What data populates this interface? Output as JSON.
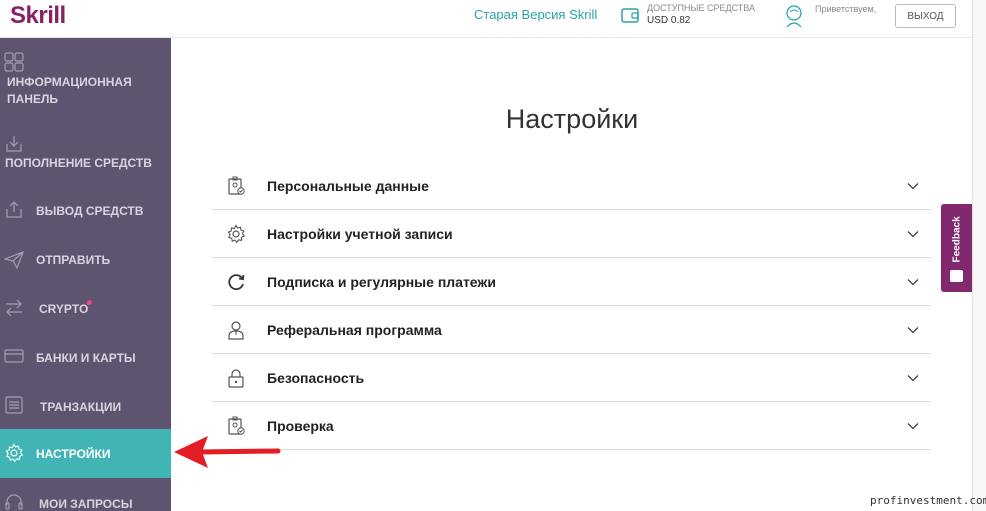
{
  "header": {
    "logo": "Skrill",
    "old_version_link": "Старая Версия Skrill",
    "balance_label": "ДОСТУПНЫЕ СРЕДСТВА",
    "balance_value": "USD 0.82",
    "greeting": "Приветствуем,",
    "logout_label": "ВЫХОД"
  },
  "sidebar": {
    "items": [
      {
        "label": "ИНФОРМАЦИОННАЯ ПАНЕЛЬ",
        "icon": "dashboard-icon"
      },
      {
        "label": "ПОПОЛНЕНИЕ СРЕДСТВ",
        "icon": "deposit-icon"
      },
      {
        "label": "ВЫВОД СРЕДСТВ",
        "icon": "withdraw-icon"
      },
      {
        "label": "ОТПРАВИТЬ",
        "icon": "send-icon"
      },
      {
        "label": "CRYPTO",
        "icon": "crypto-exchange-icon"
      },
      {
        "label": "БАНКИ И КАРТЫ",
        "icon": "bank-card-icon"
      },
      {
        "label": "ТРАНЗАКЦИИ",
        "icon": "transactions-icon"
      },
      {
        "label": "НАСТРОЙКИ",
        "icon": "gear-icon",
        "active": true
      },
      {
        "label": "МОИ ЗАПРОСЫ",
        "icon": "headset-icon"
      }
    ]
  },
  "main": {
    "title": "Настройки",
    "settings": [
      {
        "label": "Персональные данные",
        "icon": "id-badge-icon"
      },
      {
        "label": "Настройки учетной записи",
        "icon": "gear-icon"
      },
      {
        "label": "Подписка и регулярные платежи",
        "icon": "refresh-icon"
      },
      {
        "label": "Реферальная программа",
        "icon": "person-icon"
      },
      {
        "label": "Безопасность",
        "icon": "lock-icon"
      },
      {
        "label": "Проверка",
        "icon": "id-badge-icon"
      }
    ]
  },
  "feedback": {
    "label": "Feedback"
  },
  "watermark": "profinvestment.com",
  "colors": {
    "brand": "#862165",
    "sidebar_bg": "#5f5470",
    "active_item": "#41b5b5",
    "link": "#2aa3a7",
    "annotation_arrow": "#e31e24"
  }
}
